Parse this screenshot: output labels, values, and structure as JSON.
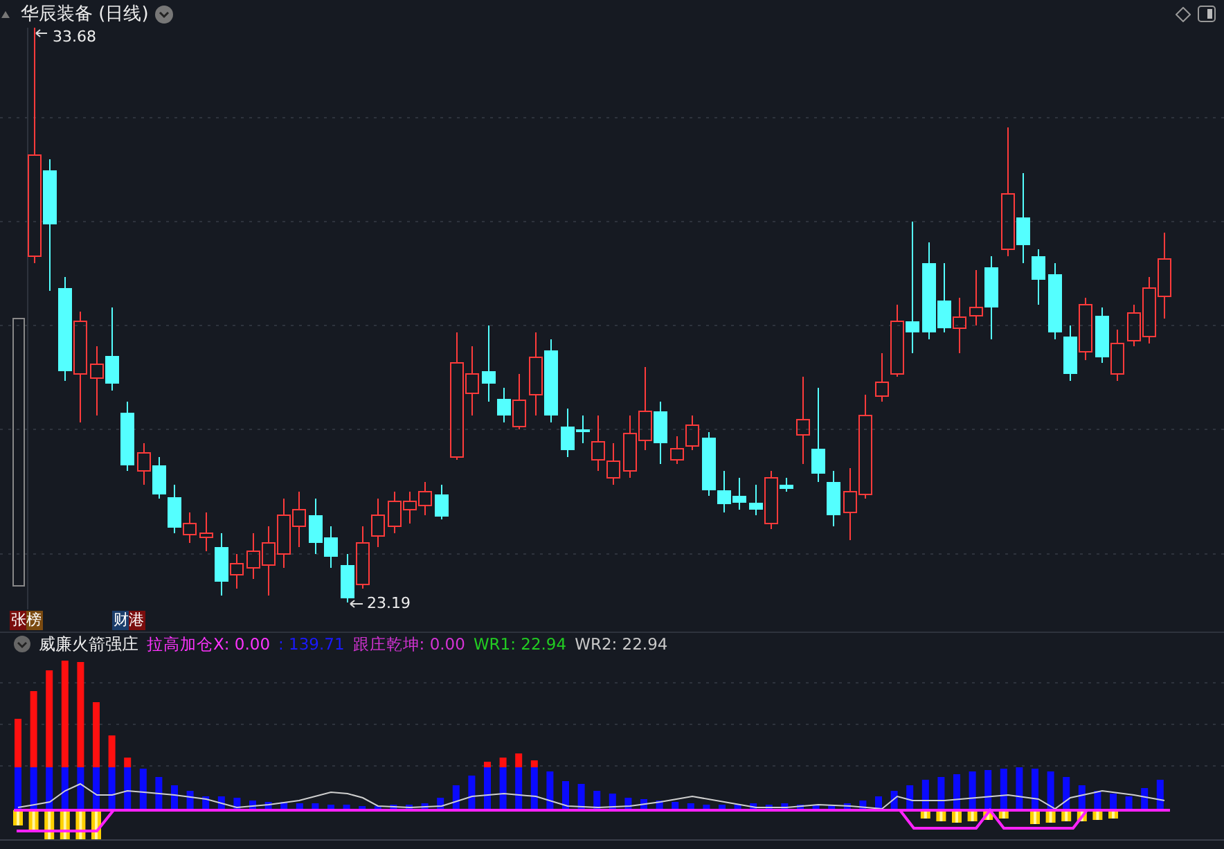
{
  "title": "华辰装备 (日线)",
  "price_marks": [
    {
      "kind": "high",
      "text": "33.68"
    },
    {
      "kind": "low",
      "text": "23.19"
    }
  ],
  "tags": [
    {
      "text": "张榜"
    },
    {
      "text": "财港"
    }
  ],
  "indicator": {
    "name": "威廉火箭强庄",
    "readouts": [
      {
        "text": "拉高加仓X: 0.00",
        "color": "#ff33ff"
      },
      {
        "text": ": 139.71",
        "color": "#1a1aff"
      },
      {
        "text": "跟庄乾坤: 0.00",
        "color": "#d633d6"
      },
      {
        "text": "WR1: 22.94",
        "color": "#22cc22"
      },
      {
        "text": "WR2: 22.94",
        "color": "#c8c8c8"
      }
    ]
  }
}
